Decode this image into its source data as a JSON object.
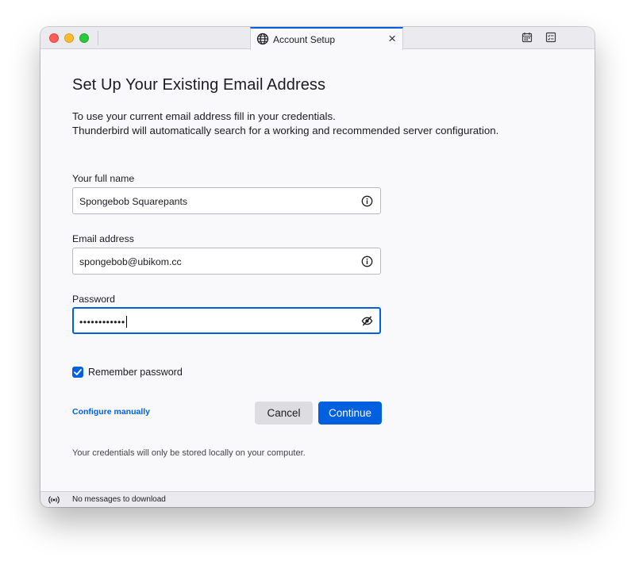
{
  "window": {
    "tab_title": "Account Setup",
    "tab_close": "×"
  },
  "icons": {
    "tab": "globe-icon",
    "calendar": "calendar-icon",
    "tasks": "tasks-icon",
    "name_info": "info-icon",
    "email_info": "info-icon",
    "password_toggle": "eye-slash-icon",
    "status": "online-status-icon"
  },
  "form": {
    "heading": "Set Up Your Existing Email Address",
    "description_line1": "To use your current email address fill in your credentials.",
    "description_line2": "Thunderbird will automatically search for a working and recommended server configuration.",
    "name_label": "Your full name",
    "name_value": "Spongebob Squarepants",
    "email_label": "Email address",
    "email_value": "spongebob@ubikom.cc",
    "password_label": "Password",
    "password_value": "••••••••••••",
    "remember_label": "Remember password",
    "remember_checked": true,
    "configure_label": "Configure manually",
    "cancel_label": "Cancel",
    "continue_label": "Continue",
    "note": "Your credentials will only be stored locally on your computer."
  },
  "status": {
    "text": "No messages to download"
  },
  "colors": {
    "accent": "#0060df",
    "close": "#ff5f57",
    "minimize": "#febc2e",
    "maximize": "#28c840"
  }
}
